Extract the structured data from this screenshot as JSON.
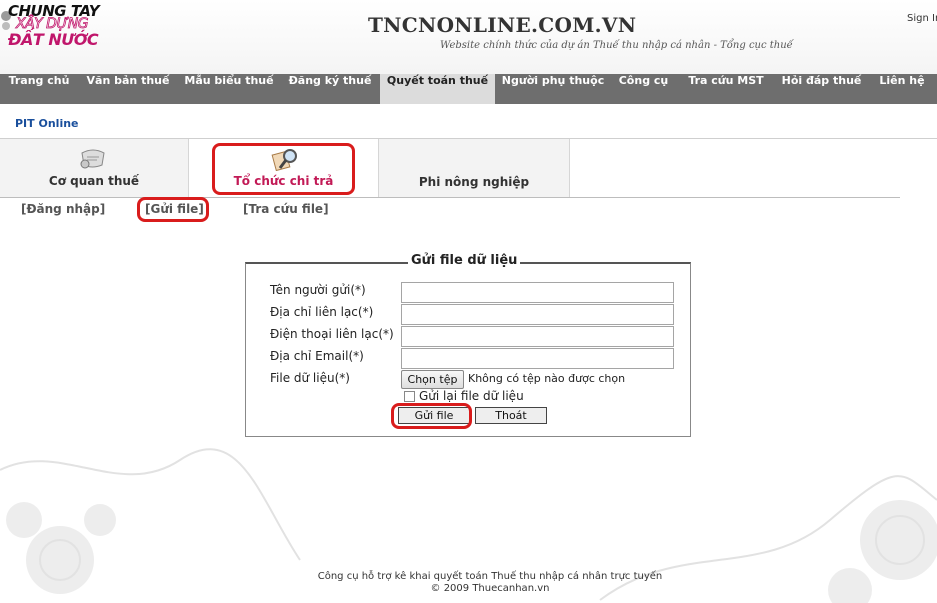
{
  "logo": {
    "line1": "CHUNG TAY",
    "line2": "XÂY DỰNG",
    "line3": "ĐẤT NƯỚC"
  },
  "header": {
    "site_title": "TNCNONLINE.COM.VN",
    "subtitle": "Website chính thức của dự án Thuế thu nhập cá nhân - Tổng cục thuế",
    "signin": "Sign In"
  },
  "nav": {
    "items": [
      {
        "label": "Trang chủ"
      },
      {
        "label": "Văn bản thuế"
      },
      {
        "label": "Mẫu biểu thuế"
      },
      {
        "label": "Đăng ký thuế"
      },
      {
        "label": "Quyết toán thuế"
      },
      {
        "label": "Người phụ thuộc"
      },
      {
        "label": "Công cụ"
      },
      {
        "label": "Tra cứu MST"
      },
      {
        "label": "Hỏi đáp thuế"
      },
      {
        "label": "Liên hệ"
      }
    ]
  },
  "breadcrumb": {
    "label": "PIT Online"
  },
  "category_tabs": [
    {
      "label": "Cơ quan thuế",
      "icon": "scroll-icon"
    },
    {
      "label": "Tổ chức chi trả",
      "icon": "magnifier-document-icon"
    },
    {
      "label": "Phi nông nghiệp"
    }
  ],
  "sub_links": [
    {
      "label": "[Đăng nhập]"
    },
    {
      "label": "[Gửi file]"
    },
    {
      "label": "[Tra cứu file]"
    }
  ],
  "form": {
    "legend": "Gửi file dữ liệu",
    "fields": [
      {
        "label": "Tên người gửi(*)",
        "value": ""
      },
      {
        "label": "Địa chỉ liên lạc(*)",
        "value": ""
      },
      {
        "label": "Điện thoại liên lạc(*)",
        "value": ""
      },
      {
        "label": "Địa chỉ Email(*)",
        "value": ""
      }
    ],
    "file_label": "File dữ liệu(*)",
    "choose_button": "Chọn tệp",
    "no_file_text": "Không có tệp nào được chọn",
    "resend_label": "Gửi lại file dữ liệu",
    "resend_checked": false,
    "submit_button": "Gửi file",
    "exit_button": "Thoát"
  },
  "footer": {
    "line1": "Công cụ hỗ trợ kê khai quyết toán Thuế thu nhập cá nhân trực tuyến",
    "line2": "© 2009 Thuecanhan.vn"
  },
  "colors": {
    "nav_bg": "#6e6e6e",
    "nav_active": "#dcdcdc",
    "highlight": "#d91c1c",
    "selected_tab_text": "#c21a56",
    "link_blue": "#1a4f9c"
  }
}
